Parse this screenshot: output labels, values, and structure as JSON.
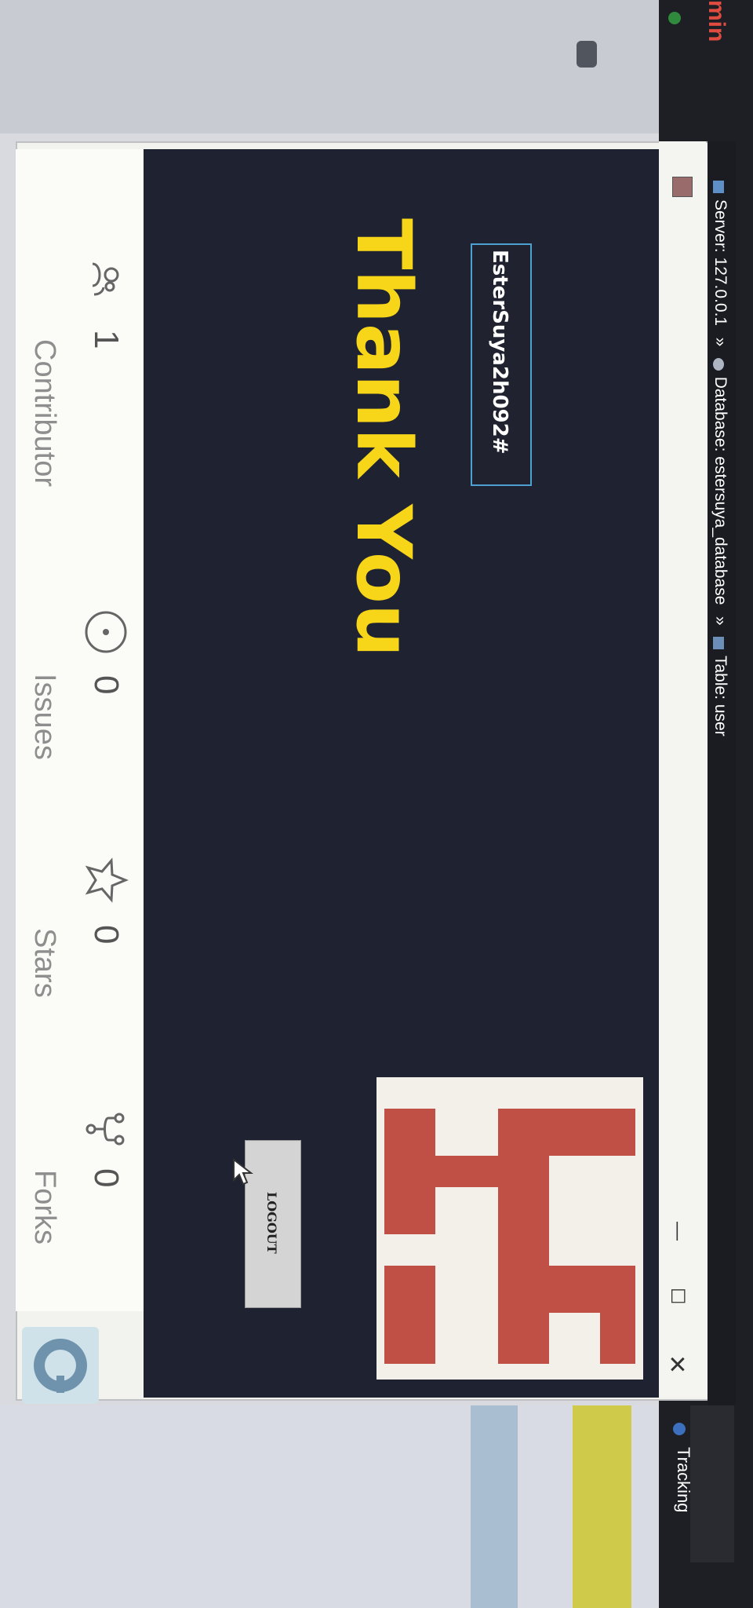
{
  "breadcrumb": {
    "server": "Server: 127.0.0.1",
    "database": "Database: estersuya_database",
    "table": "Table: user",
    "separator": "»"
  },
  "background": {
    "corner_text": "min",
    "tracking_label": "Tracking"
  },
  "window": {
    "minimize": "—",
    "maximize": "☐",
    "close": "✕"
  },
  "main": {
    "username": "EsterSuya2h092#",
    "title": "Thank You",
    "logout_label": "LOGOUT"
  },
  "stats": [
    {
      "icon": "contributor-icon",
      "value": "1",
      "label": "Contributor"
    },
    {
      "icon": "issue-icon",
      "value": "0",
      "label": "Issues"
    },
    {
      "icon": "star-icon",
      "value": "0",
      "label": "Stars"
    },
    {
      "icon": "fork-icon",
      "value": "0",
      "label": "Forks"
    }
  ],
  "colors": {
    "title": "#f7d61a",
    "panel": "#1f2230",
    "avatar_red": "#c05045",
    "username_border": "#4da0cf"
  }
}
